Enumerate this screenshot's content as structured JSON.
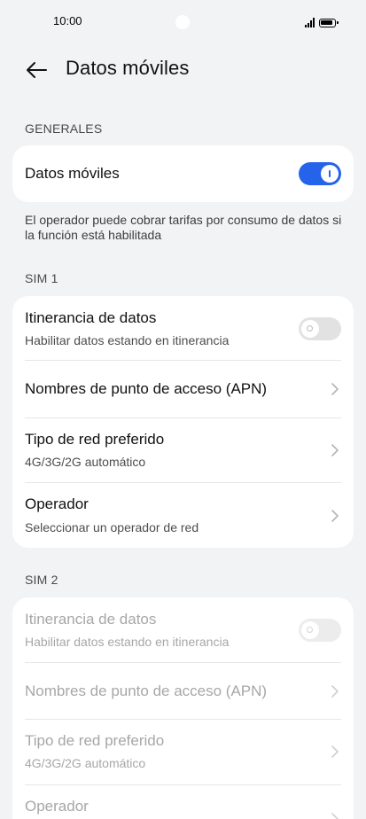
{
  "status_bar": {
    "time": "10:00",
    "icons": [
      "signal-icon",
      "battery-icon"
    ]
  },
  "header": {
    "back_icon": "arrow-left-icon",
    "title": "Datos móviles"
  },
  "general": {
    "section_label": "GENERALES",
    "mobile_data": {
      "title": "Datos móviles",
      "enabled": true
    },
    "description": "El operador puede cobrar tarifas por consumo de datos si la función está habilitada"
  },
  "sim1": {
    "section_label": "SIM 1",
    "roaming": {
      "title": "Itinerancia de datos",
      "subtitle": "Habilitar datos estando en itinerancia",
      "enabled": false
    },
    "apn": {
      "title": "Nombres de punto de acceso (APN)"
    },
    "network_type": {
      "title": "Tipo de red preferido",
      "subtitle": "4G/3G/2G automático"
    },
    "operator": {
      "title": "Operador",
      "subtitle": "Seleccionar un operador de red"
    }
  },
  "sim2": {
    "section_label": "SIM 2",
    "roaming": {
      "title": "Itinerancia de datos",
      "subtitle": "Habilitar datos estando en itinerancia",
      "enabled": false
    },
    "apn": {
      "title": "Nombres de punto de acceso (APN)"
    },
    "network_type": {
      "title": "Tipo de red preferido",
      "subtitle": "4G/3G/2G automático"
    },
    "operator": {
      "title": "Operador"
    }
  },
  "colors": {
    "accent": "#2563eb",
    "background": "#f1f3f5",
    "card": "#ffffff",
    "disabled_text": "#a7a7a7"
  }
}
